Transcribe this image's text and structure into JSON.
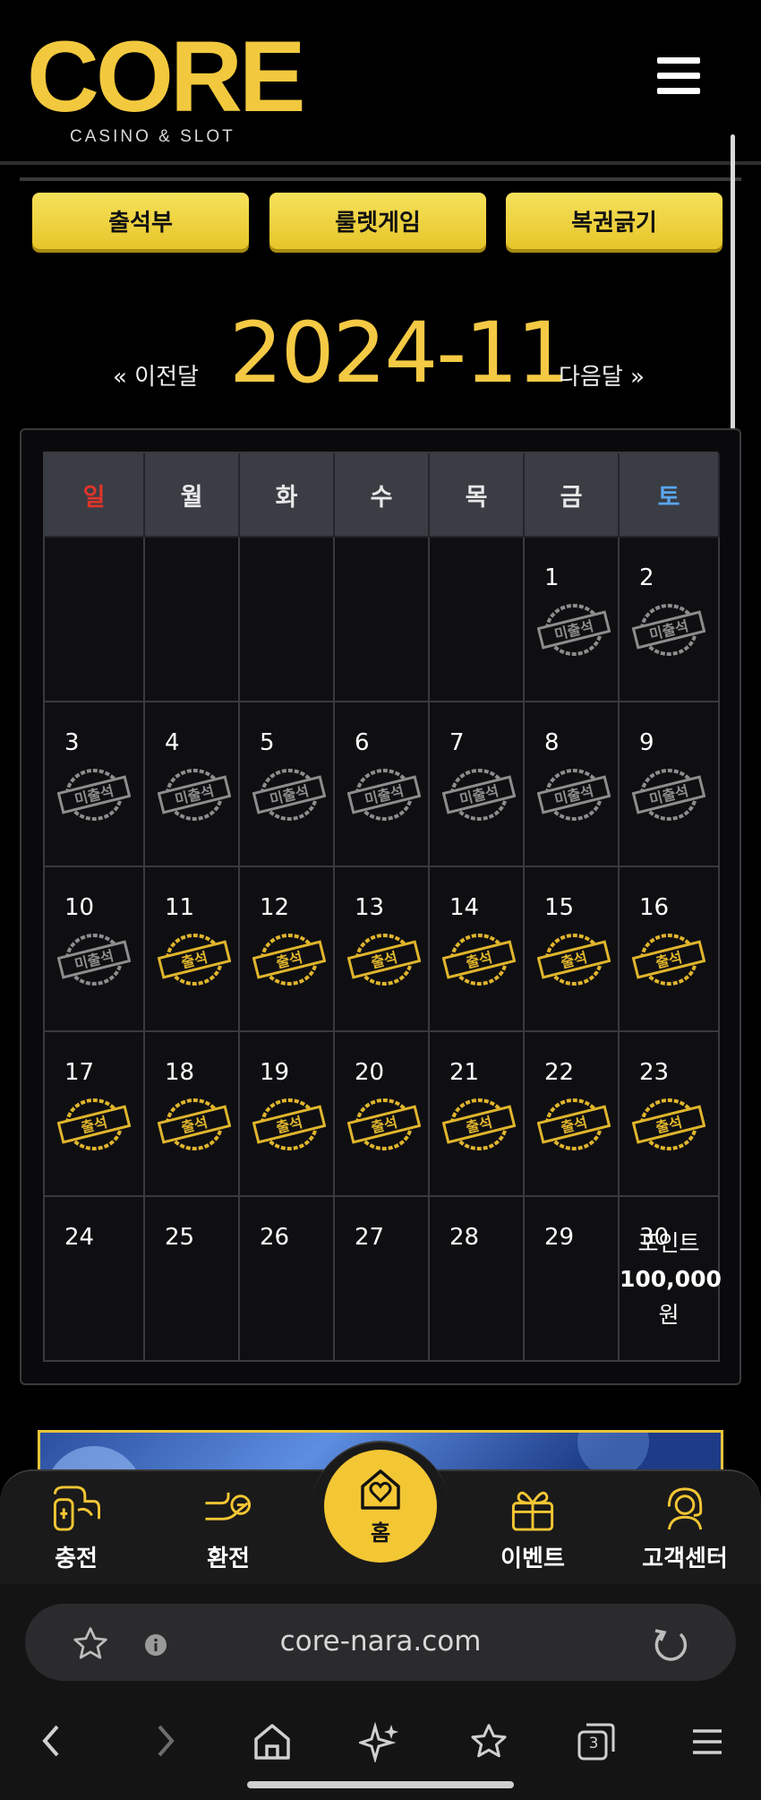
{
  "header": {
    "logo_word": "CORE",
    "logo_sub": "CASINO & SLOT"
  },
  "tabs": [
    {
      "label": "출석부"
    },
    {
      "label": "룰렛게임"
    },
    {
      "label": "복권긁기"
    }
  ],
  "month_nav": {
    "prev": "« 이전달",
    "current": "2024-11",
    "next": "다음달 »"
  },
  "calendar": {
    "weekdays": [
      "일",
      "월",
      "화",
      "수",
      "목",
      "금",
      "토"
    ],
    "stamp_missed": "미출석",
    "stamp_attended": "출석",
    "bonus": {
      "line1": "포인트",
      "line2": "100,000",
      "line3": "원"
    }
  },
  "colors": {
    "accent": "#f3c634",
    "sunday": "#e0342a",
    "saturday": "#5aa7f0",
    "stamp_missed": "#8d8d8d",
    "stamp_attended": "#e0b52c"
  },
  "bottom_nav": {
    "items": [
      {
        "label": "충전",
        "icon": "charge-icon"
      },
      {
        "label": "환전",
        "icon": "exchange-icon"
      },
      {
        "label": "홈",
        "icon": "home-heart-icon"
      },
      {
        "label": "이벤트",
        "icon": "gift-icon"
      },
      {
        "label": "고객센터",
        "icon": "support-icon"
      }
    ]
  },
  "browser": {
    "url": "core-nara.com",
    "tab_count": "3"
  }
}
